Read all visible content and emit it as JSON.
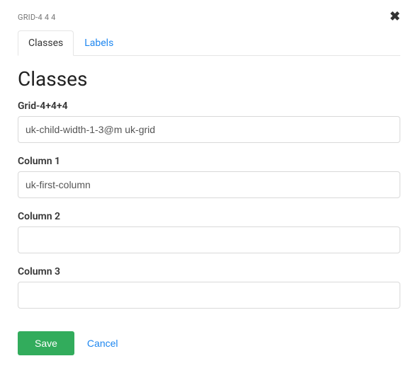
{
  "header": {
    "breadcrumb": "GRID-4 4 4",
    "close_glyph": "✖"
  },
  "tabs": [
    {
      "id": "classes",
      "label": "Classes",
      "active": true
    },
    {
      "id": "labels",
      "label": "Labels",
      "active": false
    }
  ],
  "section": {
    "title": "Classes"
  },
  "fields": [
    {
      "id": "grid",
      "label": "Grid-4+4+4",
      "value": "uk-child-width-1-3@m uk-grid"
    },
    {
      "id": "col1",
      "label": "Column 1",
      "value": "uk-first-column"
    },
    {
      "id": "col2",
      "label": "Column 2",
      "value": ""
    },
    {
      "id": "col3",
      "label": "Column 3",
      "value": ""
    }
  ],
  "actions": {
    "save_label": "Save",
    "cancel_label": "Cancel"
  }
}
